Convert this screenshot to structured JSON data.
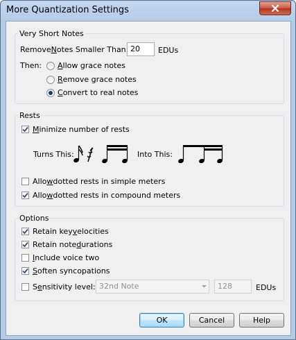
{
  "window": {
    "title": "More Quantization Settings"
  },
  "very_short_notes": {
    "legend": "Very Short Notes",
    "remove_label_pre": "Remove ",
    "remove_label_u": "N",
    "remove_label_post": "otes Smaller Than:",
    "remove_value": "20",
    "remove_unit": "EDUs",
    "then_label": "Then:",
    "options": [
      {
        "pre": "",
        "u": "A",
        "post": "llow grace notes",
        "selected": false
      },
      {
        "pre": "",
        "u": "R",
        "post": "emove grace notes",
        "selected": false
      },
      {
        "pre": "",
        "u": "C",
        "post": "onvert to real notes",
        "selected": true
      }
    ]
  },
  "rests": {
    "legend": "Rests",
    "minimize": {
      "pre": "",
      "u": "M",
      "post": "inimize number of rests",
      "checked": true
    },
    "turns_this": "Turns This:",
    "into_this": "Into This:",
    "dotted_simple": {
      "pre": "Allo",
      "u": "w",
      "post": " dotted rests in simple meters",
      "checked": false
    },
    "dotted_compound": {
      "pre": "Allo",
      "u": "w",
      "post": " dotted rests in compound meters",
      "checked": true
    }
  },
  "options": {
    "legend": "Options",
    "items": [
      {
        "pre": "Retain key ",
        "u": "v",
        "post": "elocities",
        "checked": true
      },
      {
        "pre": "Retain note ",
        "u": "d",
        "post": "urations",
        "checked": true
      },
      {
        "pre": "",
        "u": "I",
        "post": "nclude voice two",
        "checked": false
      },
      {
        "pre": "",
        "u": "S",
        "post": "often syncopations",
        "checked": true
      }
    ],
    "sensitivity": {
      "pre": "S",
      "u": "e",
      "post": "nsitivity level:",
      "checked": false
    },
    "sensitivity_select": "32nd Note",
    "sensitivity_value": "128",
    "sensitivity_unit": "EDUs"
  },
  "buttons": {
    "ok": "OK",
    "cancel": "Cancel",
    "help": "Help"
  }
}
